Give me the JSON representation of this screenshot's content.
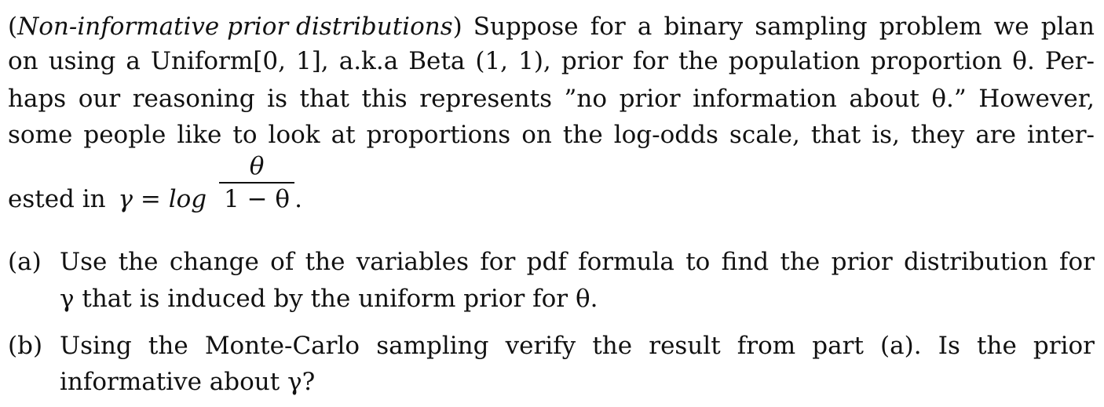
{
  "problem": {
    "heading": "Non-informative prior distributions",
    "paragraph_lines": [
      "Suppose for a binary sampling problem we plan",
      "on using a Uniform[0, 1], a.k.a Beta (1, 1), prior for the population proportion θ. Per-",
      "haps our reasoning is that this represents ”no prior information about θ.” However,",
      "some people like to look at proportions on the log-odds scale, that is, they are inter-"
    ],
    "last_line_prefix": "ested in",
    "gamma_expr": "γ = log",
    "fraction_numerator": "θ",
    "fraction_denominator": "1 − θ",
    "last_line_suffix": "."
  },
  "items": [
    {
      "label": "(a)",
      "lines": [
        "Use the change of the variables for pdf formula to find the prior distribution for",
        "γ that is induced by the uniform prior for θ."
      ]
    },
    {
      "label": "(b)",
      "lines": [
        "Using the Monte-Carlo sampling verify the result from part (a).  Is the prior",
        "informative about γ?"
      ]
    }
  ]
}
